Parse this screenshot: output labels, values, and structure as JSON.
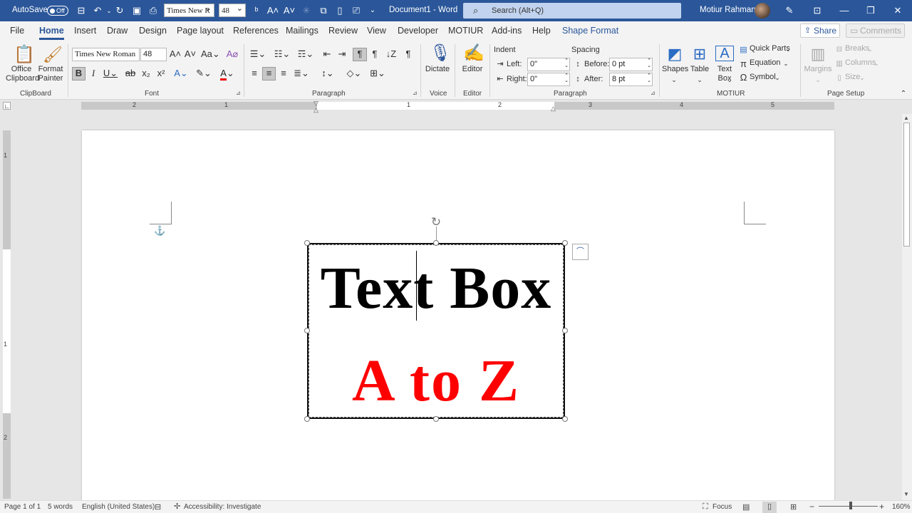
{
  "titlebar": {
    "autosave_label": "AutoSave",
    "autosave_state": "Off",
    "font_name": "Times New R",
    "font_size": "48",
    "doc_title": "Document1  -  Word",
    "search_placeholder": "Search (Alt+Q)",
    "user_name": "Motiur Rahman"
  },
  "tabs": [
    "File",
    "Home",
    "Insert",
    "Draw",
    "Design",
    "Page layout",
    "References",
    "Mailings",
    "Review",
    "View",
    "Developer",
    "MOTIUR",
    "Add-ins",
    "Help",
    "Shape Format"
  ],
  "share_label": "Share",
  "comments_label": "Comments",
  "ribbon": {
    "clipboard": {
      "office_clipboard": "Office\nClipboard",
      "format_painter": "Format\nPainter",
      "group": "ClipBoard"
    },
    "font": {
      "name": "Times New Roman",
      "size": "48",
      "group": "Font"
    },
    "paragraph_group": "Paragraph",
    "voice": {
      "dictate": "Dictate",
      "group": "Voice"
    },
    "editor": {
      "label": "Editor",
      "group": "Editor"
    },
    "indent": {
      "title": "Indent",
      "left_label": "Left:",
      "left_value": "0\"",
      "right_label": "Right:",
      "right_value": "0\""
    },
    "spacing": {
      "title": "Spacing",
      "before_label": "Before:",
      "before_value": "0 pt",
      "after_label": "After:",
      "after_value": "8 pt"
    },
    "paragraph2_group": "Paragraph",
    "motiur": {
      "shapes": "Shapes",
      "table": "Table",
      "textbox": "Text\nBox",
      "quick_parts": "Quick Parts",
      "equation": "Equation",
      "symbol": "Symbol",
      "group": "MOTIUR"
    },
    "page_setup": {
      "margins": "Margins",
      "breaks": "Breaks",
      "columns": "Columns",
      "size": "Size",
      "group": "Page Setup"
    }
  },
  "ruler": {
    "h_numbers": [
      "2",
      "1",
      "1",
      "2",
      "3",
      "4",
      "5"
    ],
    "v_numbers": [
      "1",
      "1",
      "2"
    ]
  },
  "document": {
    "textbox_line1": "Text Box",
    "textbox_line2": "A to Z",
    "line2_color": "#ff0000"
  },
  "status": {
    "page": "Page 1 of 1",
    "words": "5 words",
    "language": "English (United States)",
    "accessibility": "Accessibility: Investigate",
    "focus": "Focus",
    "zoom": "160%"
  }
}
